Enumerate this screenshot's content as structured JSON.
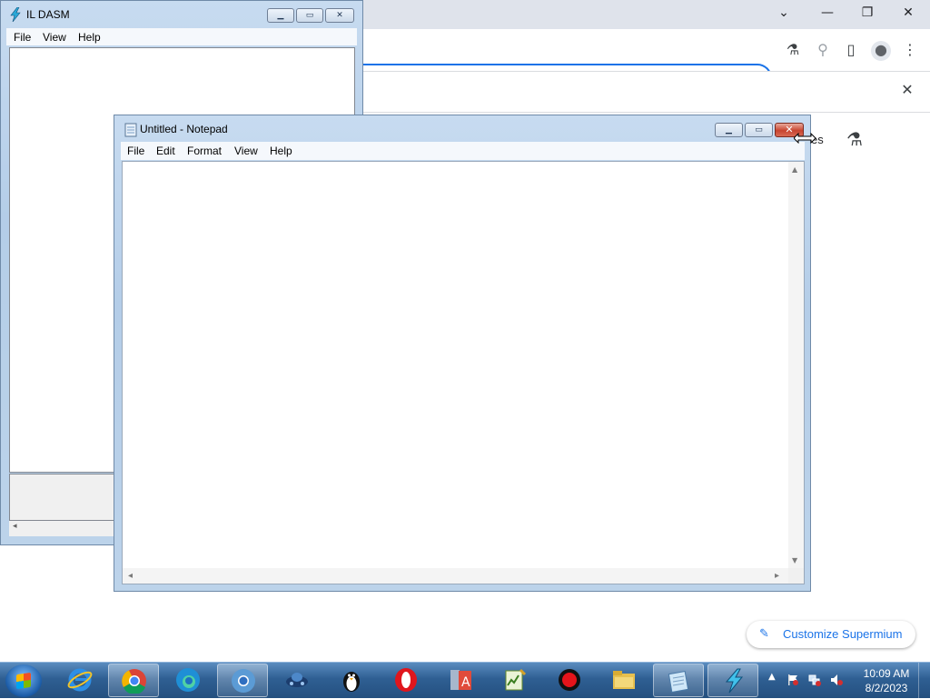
{
  "browser": {
    "window_controls": {
      "dropdown": "⌄",
      "minimize": "—",
      "restore": "❐",
      "close": "✕"
    },
    "toolbar_icons": {
      "share": "⇪",
      "star": "☆",
      "labs": "⚗",
      "search": "⚲",
      "sidepanel": "▯",
      "profile": "●",
      "menu": "⋮"
    },
    "infobar_close": "✕",
    "ntp_partial_text": "es",
    "labs_icon": "⚗",
    "customize_pencil": "✎",
    "customize_label": "Customize Supermium"
  },
  "ildasm": {
    "title": "IL DASM",
    "menu": [
      "File",
      "View",
      "Help"
    ],
    "scroll_left": "◂"
  },
  "notepad": {
    "title": "Untitled - Notepad",
    "menu": [
      "File",
      "Edit",
      "Format",
      "View",
      "Help"
    ],
    "scroll_up": "▲",
    "scroll_down": "▼",
    "scroll_left": "◂",
    "scroll_right": "▸"
  },
  "caption_buttons": {
    "minimize": "▁",
    "maximize": "▭",
    "close": "✕"
  },
  "taskbar": {
    "pinned": [
      "Internet Explorer",
      "Google Chrome",
      "Microsoft Edge",
      "Chromium",
      "Network Tool",
      "Penguin App",
      "Opera",
      "Access Database",
      "Notepad++",
      "Recorder",
      "Windows Explorer",
      "Notepad",
      "IL DASM"
    ],
    "active_index": 3,
    "tray_arrow": "▲",
    "time": "10:09 AM",
    "date": "8/2/2023"
  },
  "colors": {
    "accent": "#1a73e8",
    "taskbar": "#2f5f93",
    "close_button": "#c8442f"
  }
}
